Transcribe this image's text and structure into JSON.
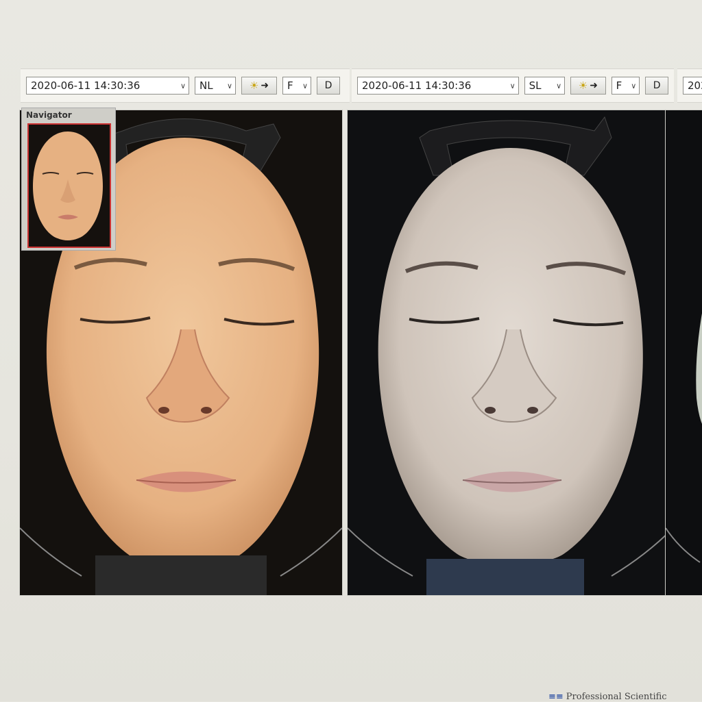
{
  "toolbars": [
    {
      "date": "2020-06-11 14:30:36",
      "mode": "NL",
      "filter": "F",
      "button": "D"
    },
    {
      "date": "2020-06-11 14:30:36",
      "mode": "SL",
      "filter": "F",
      "button": "D"
    },
    {
      "date_partial": "202"
    }
  ],
  "icons": {
    "light": "sun-icon",
    "arrow": "arrow-right-icon",
    "dropdown": "chevron-down-icon"
  },
  "navigator": {
    "title": "Navigator"
  },
  "footer": {
    "brand": "Professional Scientific"
  },
  "colors": {
    "skin_nl": "#e8b98a",
    "skin_sl": "#d9cfc6",
    "highlight_frame": "#cc3333",
    "sun": "#c9a514"
  }
}
